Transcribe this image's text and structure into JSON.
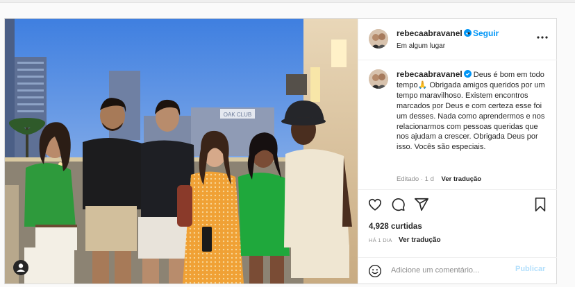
{
  "post": {
    "username": "rebecaabravanel",
    "follow_label": "Seguir",
    "separator": "•",
    "location": "Em algum lugar",
    "caption": "Deus é bom em todo tempo🙏 Obrigada amigos queridos por um tempo maravilhoso. Existem encontros marcados por Deus e com certeza esse foi um desses. Nada como aprendermos e nos relacionarmos com pessoas queridas que nos ajudam a crescer. Obrigada Deus por isso. Vocês são especiais.",
    "edited_label": "Editado · 1 d",
    "see_translation_caption": "Ver tradução",
    "likes": "4,928 curtidas",
    "time_ago": "HÁ 1 DIA",
    "see_translation_post": "Ver tradução",
    "comment_placeholder": "Adicione um comentário...",
    "publish_label": "Publicar",
    "sign_text": "OAK CLUB"
  },
  "icons": {
    "verified": "verified-badge-icon",
    "more": "more-options-icon",
    "like": "heart-icon",
    "comment": "comment-icon",
    "share": "share-icon",
    "save": "bookmark-icon",
    "emoji": "emoji-icon",
    "tagged": "user-tag-icon"
  },
  "colors": {
    "link_blue": "#0095f6",
    "publish_disabled": "#b2dffc",
    "muted": "#8e8e8e",
    "text": "#262626"
  }
}
